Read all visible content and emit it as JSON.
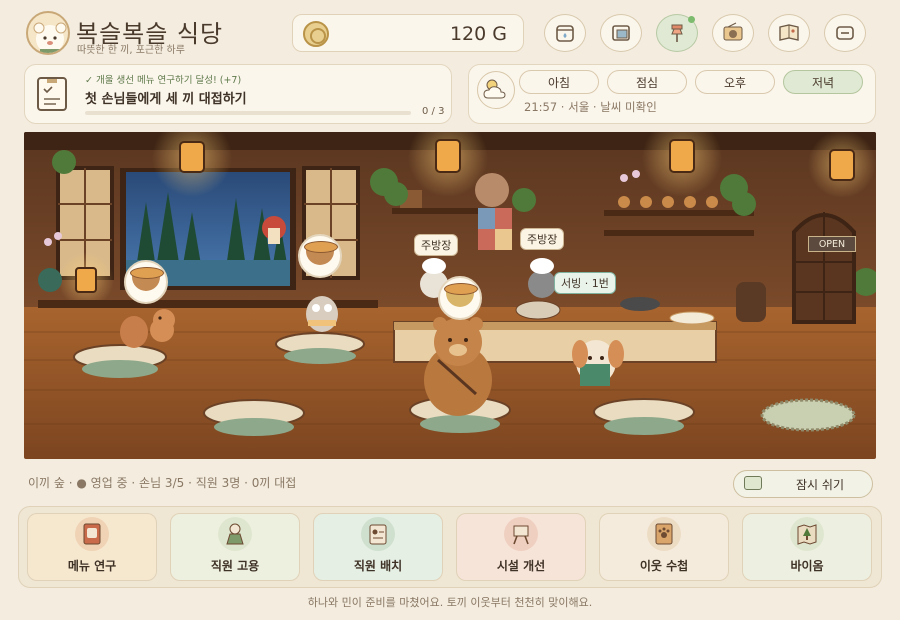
{
  "header": {
    "title": "복슬복슬 식당",
    "subtitle": "따뜻한 한 끼, 포근한 하루",
    "gold": "120 G",
    "toolbar": [
      {
        "name": "tip-jar-icon"
      },
      {
        "name": "frame-icon"
      },
      {
        "name": "pin-icon",
        "active": true,
        "notify": true
      },
      {
        "name": "radio-icon"
      },
      {
        "name": "journal-icon"
      },
      {
        "name": "menu-icon"
      }
    ]
  },
  "quest": {
    "sub": "✓ 개울 생선 메뉴 연구하기 달성! (+7)",
    "title": "첫 손님들에게 세 끼 대접하기",
    "progress_text": "0 / 3",
    "progress": 0
  },
  "time": {
    "tabs": [
      "아침",
      "점심",
      "오후",
      "저녁"
    ],
    "active": "저녁",
    "info": "21:57 · 서울 · 날씨 미확인"
  },
  "scene": {
    "labels": {
      "kitchen1": "주방장",
      "kitchen2": "주방장",
      "serving": "서빙 · 1번",
      "open_sign": "OPEN"
    }
  },
  "status": {
    "text": "이끼 숲 · ● 영업 중 · 손님 3/5 · 직원 3명 · 0끼 대접",
    "rest_label": "잠시 쉬기"
  },
  "actions": [
    {
      "label": "메뉴 연구",
      "icon": "menu-book-icon",
      "bg": "#f6e7cf"
    },
    {
      "label": "직원 고용",
      "icon": "staff-icon",
      "bg": "#eef0df"
    },
    {
      "label": "직원 배치",
      "icon": "id-card-icon",
      "bg": "#e5efe4"
    },
    {
      "label": "시설 개선",
      "icon": "easel-icon",
      "bg": "#f7e4d9"
    },
    {
      "label": "이웃 수첩",
      "icon": "paw-book-icon",
      "bg": "#f5ebdc"
    },
    {
      "label": "바이옴",
      "icon": "map-icon",
      "bg": "#edf0e0"
    }
  ],
  "hint": "하나와 민이 준비를 마쳤어요. 토끼 이웃부터 천천히 맞이해요.",
  "colors": {
    "accent_green": "#7dbb6e",
    "active_tab": "#dfe9d3",
    "panel": "#fbf6ec"
  }
}
